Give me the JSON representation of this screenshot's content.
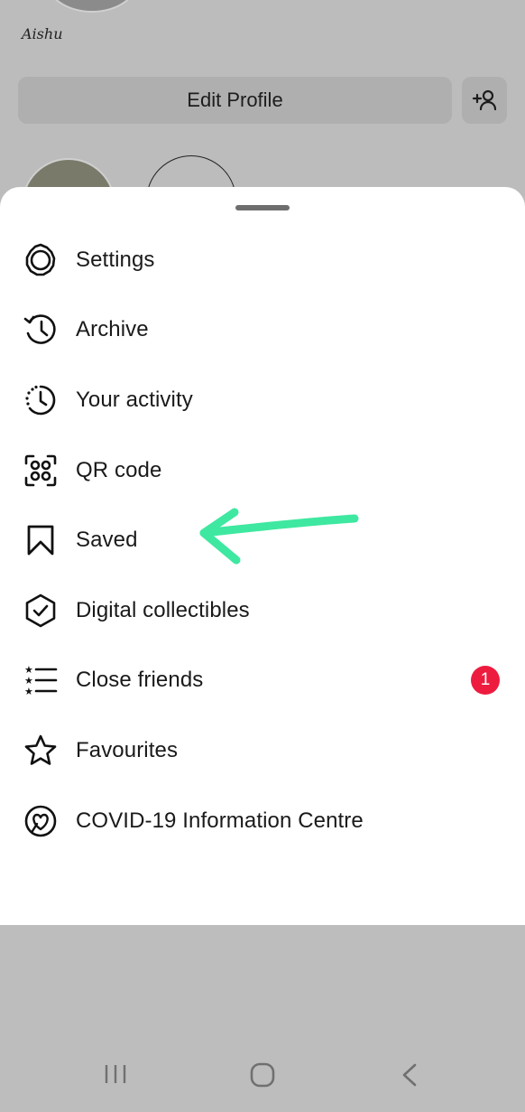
{
  "profile": {
    "name": "Aishu",
    "edit_button": "Edit Profile"
  },
  "menu": {
    "items": [
      {
        "label": "Settings",
        "icon": "settings-icon"
      },
      {
        "label": "Archive",
        "icon": "archive-icon"
      },
      {
        "label": "Your activity",
        "icon": "activity-icon"
      },
      {
        "label": "QR code",
        "icon": "qr-code-icon"
      },
      {
        "label": "Saved",
        "icon": "bookmark-icon"
      },
      {
        "label": "Digital collectibles",
        "icon": "collectibles-icon"
      },
      {
        "label": "Close friends",
        "icon": "close-friends-icon",
        "badge": "1"
      },
      {
        "label": "Favourites",
        "icon": "star-icon"
      },
      {
        "label": "COVID-19 Information Centre",
        "icon": "covid-heart-icon"
      }
    ]
  },
  "colors": {
    "badge": "#ed1c3f",
    "annotation_arrow": "#3ee8a0"
  }
}
